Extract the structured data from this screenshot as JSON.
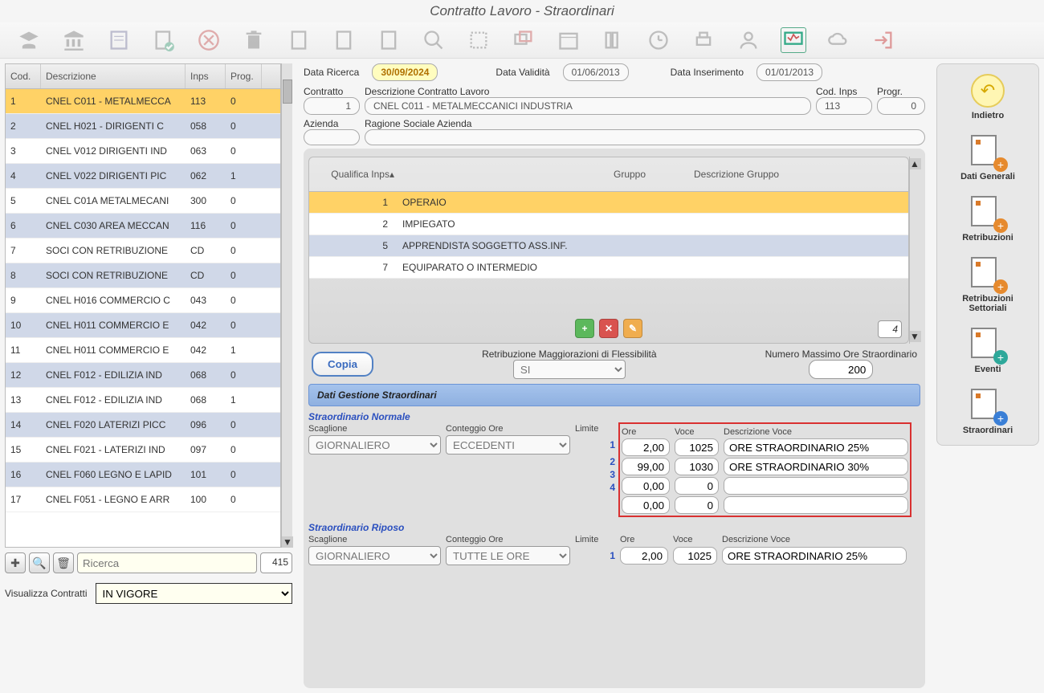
{
  "title": "Contratto Lavoro - Straordinari",
  "dates": {
    "ricerca_lbl": "Data Ricerca",
    "ricerca": "30/09/2024",
    "validita_lbl": "Data Validità",
    "validita": "01/06/2013",
    "inserimento_lbl": "Data Inserimento",
    "inserimento": "01/01/2013"
  },
  "contract": {
    "contratto_lbl": "Contratto",
    "num": "1",
    "desc_lbl": "Descrizione Contratto Lavoro",
    "desc": "CNEL C011 - METALMECCANICI INDUSTRIA",
    "inps_lbl": "Cod. Inps",
    "inps": "113",
    "prog_lbl": "Progr.",
    "prog": "0",
    "azienda_lbl": "Azienda",
    "azienda": "",
    "rag_lbl": "Ragione Sociale Azienda",
    "rag": ""
  },
  "left_table": {
    "headers": {
      "cod": "Cod.",
      "desc": "Descrizione",
      "inps": "Inps",
      "prog": "Prog."
    },
    "rows": [
      {
        "cod": "1",
        "desc": "CNEL C011 - METALMECCA",
        "inps": "113",
        "prog": "0",
        "sel": true
      },
      {
        "cod": "2",
        "desc": "CNEL H021 - DIRIGENTI C",
        "inps": "058",
        "prog": "0",
        "alt": true
      },
      {
        "cod": "3",
        "desc": "CNEL V012 DIRIGENTI IND",
        "inps": "063",
        "prog": "0"
      },
      {
        "cod": "4",
        "desc": "CNEL V022 DIRIGENTI PIC",
        "inps": "062",
        "prog": "1",
        "alt": true
      },
      {
        "cod": "5",
        "desc": "CNEL C01A METALMECANI",
        "inps": "300",
        "prog": "0"
      },
      {
        "cod": "6",
        "desc": "CNEL C030 AREA MECCAN",
        "inps": "116",
        "prog": "0",
        "alt": true
      },
      {
        "cod": "7",
        "desc": "SOCI CON RETRIBUZIONE",
        "inps": "CD",
        "prog": "0"
      },
      {
        "cod": "8",
        "desc": "SOCI CON RETRIBUZIONE",
        "inps": "CD",
        "prog": "0",
        "alt": true
      },
      {
        "cod": "9",
        "desc": "CNEL H016 COMMERCIO C",
        "inps": "043",
        "prog": "0"
      },
      {
        "cod": "10",
        "desc": "CNEL H011 COMMERCIO E",
        "inps": "042",
        "prog": "0",
        "alt": true
      },
      {
        "cod": "11",
        "desc": "CNEL H011 COMMERCIO E",
        "inps": "042",
        "prog": "1"
      },
      {
        "cod": "12",
        "desc": "CNEL F012 - EDILIZIA IND",
        "inps": "068",
        "prog": "0",
        "alt": true
      },
      {
        "cod": "13",
        "desc": "CNEL F012 - EDILIZIA IND",
        "inps": "068",
        "prog": "1"
      },
      {
        "cod": "14",
        "desc": "CNEL F020 LATERIZI PICC",
        "inps": "096",
        "prog": "0",
        "alt": true
      },
      {
        "cod": "15",
        "desc": "CNEL F021 - LATERIZI IND",
        "inps": "097",
        "prog": "0"
      },
      {
        "cod": "16",
        "desc": "CNEL F060 LEGNO E LAPID",
        "inps": "101",
        "prog": "0",
        "alt": true
      },
      {
        "cod": "17",
        "desc": "CNEL F051 - LEGNO E ARR",
        "inps": "100",
        "prog": "0"
      }
    ],
    "search_ph": "Ricerca",
    "count": "415"
  },
  "viz": {
    "label": "Visualizza Contratti",
    "value": "IN VIGORE"
  },
  "qual": {
    "headers": {
      "qi": "Qualifica Inps",
      "grp": "Gruppo",
      "dgrp": "Descrizione Gruppo"
    },
    "rows": [
      {
        "n": "1",
        "d": "OPERAIO",
        "sel": true
      },
      {
        "n": "2",
        "d": "IMPIEGATO"
      },
      {
        "n": "5",
        "d": "APPRENDISTA SOGGETTO ASS.INF.",
        "alt": true
      },
      {
        "n": "7",
        "d": "EQUIPARATO O INTERMEDIO"
      }
    ],
    "count": "4"
  },
  "copy": {
    "btn": "Copia",
    "retr_lbl": "Retribuzione Maggiorazioni di Flessibilità",
    "retr_val": "SI",
    "max_lbl": "Numero Massimo Ore Straordinario",
    "max_val": "200"
  },
  "section_bar": "Dati Gestione Straordinari",
  "str": {
    "norm_title": "Straordinario Normale",
    "rip_title": "Straordinario Riposo",
    "scag_lbl": "Scaglione",
    "scag_val": "GIORNALIERO",
    "cont_lbl": "Conteggio Ore",
    "cont_norm": "ECCEDENTI",
    "cont_rip": "TUTTE LE ORE",
    "lim_lbl": "Limite",
    "ore_lbl": "Ore",
    "voce_lbl": "Voce",
    "dvoce_lbl": "Descrizione Voce",
    "norm_rows": [
      {
        "lim": "1",
        "ore": "2,00",
        "voce": "1025",
        "dv": "ORE STRAORDINARIO 25%"
      },
      {
        "lim": "2",
        "ore": "99,00",
        "voce": "1030",
        "dv": "ORE STRAORDINARIO 30%"
      },
      {
        "lim": "3",
        "ore": "0,00",
        "voce": "0",
        "dv": ""
      },
      {
        "lim": "4",
        "ore": "0,00",
        "voce": "0",
        "dv": ""
      }
    ],
    "rip_rows": [
      {
        "lim": "1",
        "ore": "2,00",
        "voce": "1025",
        "dv": "ORE STRAORDINARIO 25%"
      }
    ]
  },
  "nav": {
    "back": "Indietro",
    "gen": "Dati Generali",
    "retr": "Retribuzioni",
    "sett1": "Retribuzioni",
    "sett2": "Settoriali",
    "ev": "Eventi",
    "str": "Straordinari"
  }
}
